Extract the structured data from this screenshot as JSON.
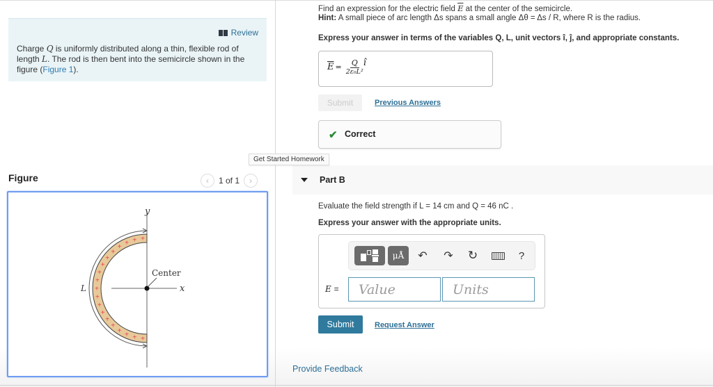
{
  "intro": {
    "review_label": "Review",
    "text_1": "Charge ",
    "var_q": "Q",
    "text_2": " is uniformly distributed along a thin, flexible rod of length ",
    "var_l": "L",
    "text_3": ". The rod is then bent into the semicircle shown in the figure (",
    "figure_link": "Figure 1",
    "text_4": ")."
  },
  "figure": {
    "title": "Figure",
    "pager": "1 of 1",
    "prev_icon": "chevron-left-icon",
    "next_icon": "chevron-right-icon",
    "labels": {
      "y": "y",
      "x": "x",
      "center": "Center",
      "length": "L"
    },
    "charge_symbol": "+",
    "colors": {
      "rod_fill": "#e8c99a",
      "charge": "#e8414b",
      "frame_border": "#6f9cf0"
    }
  },
  "tooltip": "Get Started Homework",
  "partA": {
    "prompt_1": "Find an expression for the electric field ",
    "prompt_var": "E",
    "prompt_2": " at the center of the semicircle.",
    "hint_label": "Hint:",
    "hint_text": " A small piece of arc length Δs spans a small angle Δθ = Δs / R, where R is the radius.",
    "instruction": "Express your answer in terms of the variables Q, L, unit vectors î, ĵ, and appropriate constants.",
    "answer_lhs": "E",
    "answer_eq": "=",
    "answer_num": "Q",
    "answer_den": "2ε₀L²",
    "answer_unit_vec": "î",
    "submit_label": "Submit",
    "previous_answers": "Previous Answers",
    "result_label": "Correct",
    "result_icon": "checkmark-icon",
    "colors": {
      "correct": "#2e8b3a"
    }
  },
  "partB": {
    "title": "Part B",
    "prompt": "Evaluate the field strength if L = 14 cm and Q = 46 nC .",
    "instruction": "Express your answer with the appropriate units.",
    "toolbar": {
      "templates_icon": "templates-icon",
      "units_label": "μÅ",
      "undo_icon": "undo-icon",
      "redo_icon": "redo-icon",
      "reset_icon": "reset-icon",
      "keyboard_icon": "keyboard-icon",
      "help_label": "?"
    },
    "field_label": "E",
    "field_eq": "=",
    "value_placeholder": "Value",
    "units_placeholder": "Units",
    "submit_label": "Submit",
    "request_answer": "Request Answer",
    "colors": {
      "submit_bg": "#2f7a9d",
      "link": "#2d6f96"
    }
  },
  "footer": {
    "feedback_label": "Provide Feedback"
  }
}
